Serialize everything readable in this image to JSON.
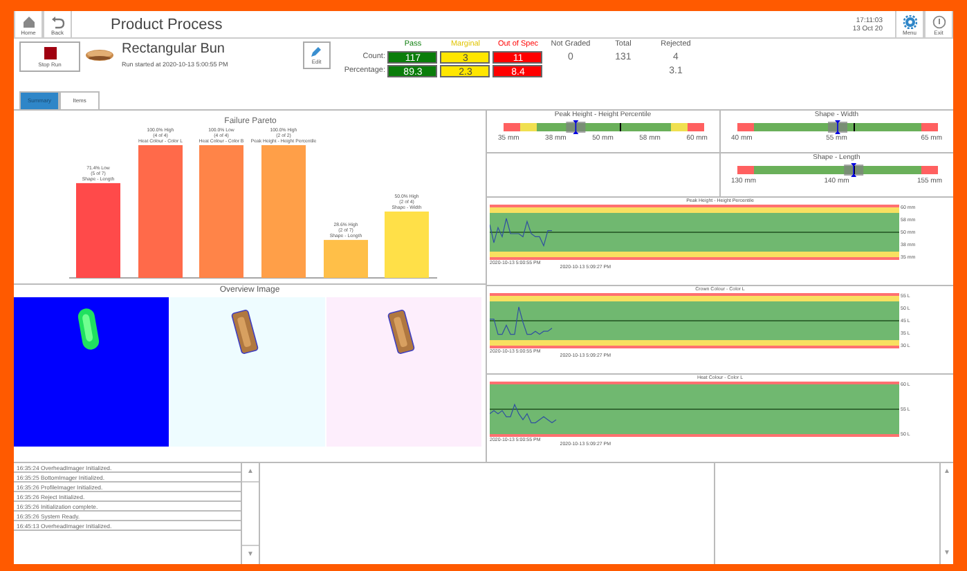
{
  "header": {
    "left_buttons": [
      {
        "label": "Home"
      },
      {
        "label": "Back"
      }
    ],
    "title": "Product Process",
    "time": "17:11:03",
    "date": "13 Oct 20",
    "right_buttons": [
      {
        "label": "Menu"
      },
      {
        "label": "Exit"
      }
    ]
  },
  "run": {
    "stop_button": "Stop Run",
    "product": "Rectangular Bun",
    "started": "Run started at 2020-10-13 5:00:55 PM",
    "edit_button": "Edit"
  },
  "stats": {
    "row_labels": [
      "Count:",
      "Percentage:"
    ],
    "columns": [
      {
        "header": "Pass",
        "kind": "boxed",
        "color": "#0a7d0a",
        "count": "117",
        "percentage": "89.3"
      },
      {
        "header": "Marginal",
        "kind": "boxed",
        "color": "#ffe600",
        "count": "3",
        "percentage": "2.3"
      },
      {
        "header": "Out of Spec",
        "kind": "boxed",
        "color": "#ff0000",
        "count": "11",
        "percentage": "8.4"
      },
      {
        "header": "Not Graded",
        "kind": "plain",
        "count": "0"
      },
      {
        "header": "Total",
        "kind": "plain",
        "count": "131"
      },
      {
        "header": "Rejected",
        "kind": "plain",
        "count": "4",
        "percentage": "3.1"
      }
    ]
  },
  "tabs": [
    {
      "label": "Summary",
      "selected": true
    },
    {
      "label": "Items",
      "selected": false
    }
  ],
  "pareto": {
    "chart_data": {
      "type": "bar",
      "title": "Failure Pareto",
      "categories": [
        "Shape - Length",
        "Heat Colour - Color L",
        "Heat Colour - Color B",
        "Peak Height - Height Percentile",
        "Shape - Length",
        "Shape - Width"
      ],
      "values": [
        71.4,
        100,
        100,
        100,
        28.6,
        50
      ],
      "value_labels": [
        "71.4% Low",
        "100.0% High",
        "100.0% Low",
        "100.0% High",
        "28.6% High",
        "50.0% High"
      ],
      "annotations": [
        "(5 of 7)",
        "(4 of 4)",
        "(4 of 4)",
        "(2 of 2)",
        "(2 of 7)",
        "(2 of 4)"
      ]
    }
  },
  "overview": {
    "title": "Overview Image"
  },
  "gauges": [
    {
      "title": "Peak Height - Height Percentile",
      "warning_bands": true,
      "level": 0.36,
      "labels": [
        "35 mm",
        "38 mm",
        "50 mm",
        "58 mm",
        "60 mm"
      ]
    },
    {
      "title": "Shape - Width",
      "warning_bands": false,
      "level": 0.5,
      "labels": [
        "40 mm",
        "55 mm",
        "65 mm"
      ]
    },
    {
      "title": "Shape - Length",
      "warning_bands": false,
      "level": 0.58,
      "labels": [
        "130 mm",
        "140 mm",
        "155 mm"
      ]
    }
  ],
  "trends": [
    {
      "title": "Peak Height - Height Percentile",
      "warning_bands": true,
      "axis_labels": [
        "60 mm",
        "58 mm",
        "50 mm",
        "38 mm",
        "35 mm"
      ],
      "start": "2020-10-13 5:00:55 PM",
      "end": "2020-10-13 5:09:27 PM"
    },
    {
      "title": "Crown Colour - Color L",
      "warning_bands": true,
      "axis_labels": [
        "55 L",
        "50 L",
        "45 L",
        "35 L",
        "30 L"
      ],
      "start": "2020-10-13 5:00:55 PM",
      "end": "2020-10-13 5:09:27 PM"
    },
    {
      "title": "Heat Colour - Color L",
      "warning_bands": false,
      "axis_labels": [
        "60 L",
        "55 L",
        "50 L"
      ],
      "start": "2020-10-13 5:00:55 PM",
      "end": "2020-10-13 5:09:27 PM"
    }
  ],
  "log": [
    "16:35:24 OverheadImager Initialized.",
    "16:35:25 BottomImager Initialized.",
    "16:35:26 ProfileImager Initialized.",
    "16:35:26 Reject Initialized.",
    "16:35:26 Initialization complete.",
    "16:35:26 System Ready.",
    "16:45:13 OverheadImager Initialized."
  ],
  "scroll_buttons": [
    "▲",
    "▼"
  ]
}
